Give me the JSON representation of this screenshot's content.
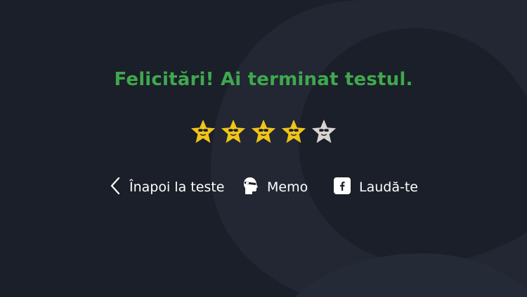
{
  "result": {
    "title": "Felicitări! Ai terminat testul."
  },
  "rating": {
    "value": 4,
    "max": 5,
    "filled_color": "#f0c419",
    "empty_color": "#d8d4cf"
  },
  "actions": {
    "back_label": "Înapoi la teste",
    "memo_label": "Memo",
    "brag_label": "Laudă-te"
  },
  "icons": {
    "back": "chevron-left-icon",
    "memo": "head-bandage-icon",
    "brag": "facebook-icon"
  },
  "colors": {
    "background": "#1b1f29",
    "title": "#3fa84e",
    "text": "#ffffff"
  }
}
